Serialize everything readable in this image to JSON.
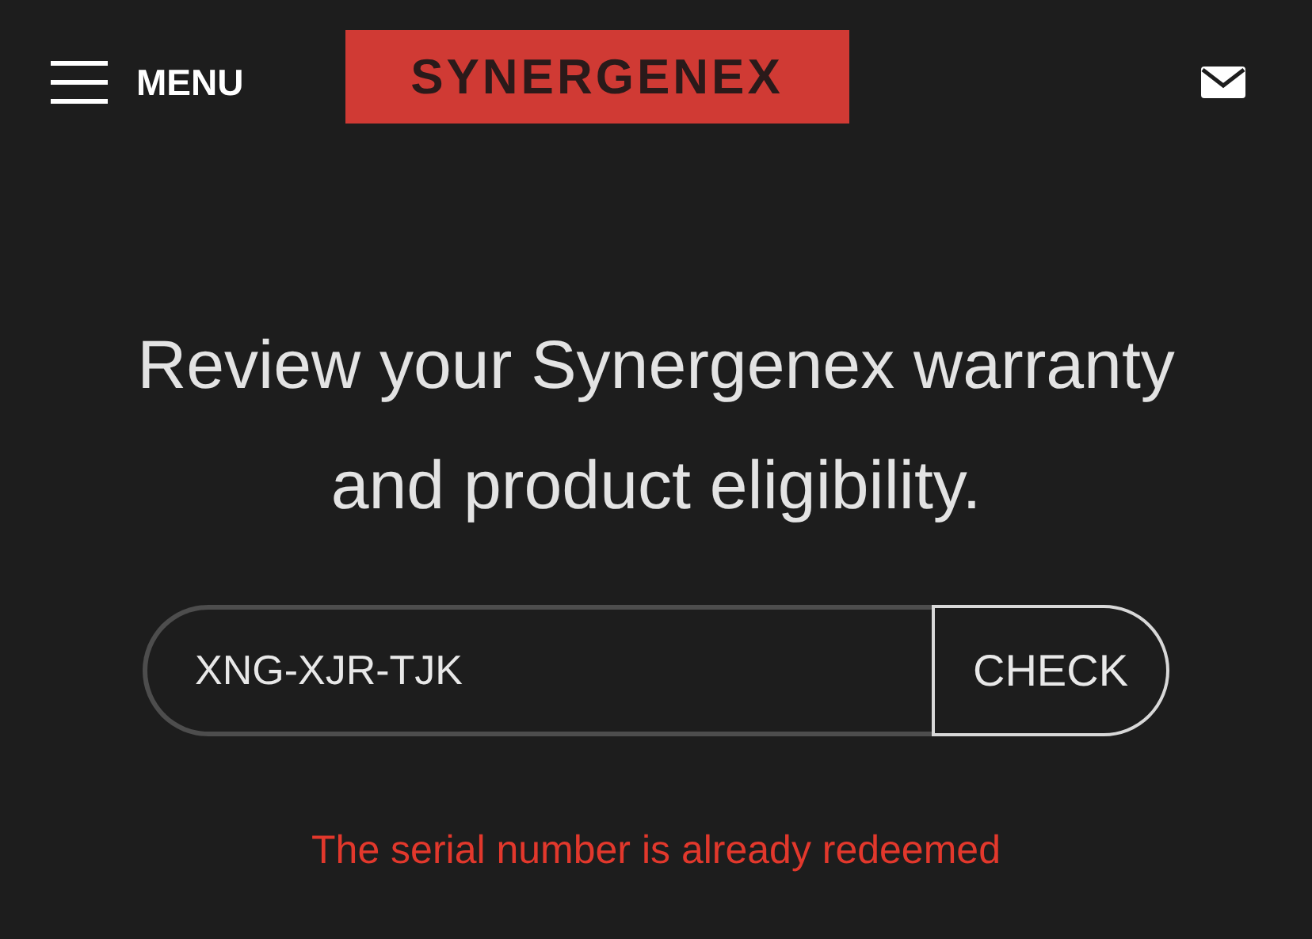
{
  "header": {
    "menu_label": "MENU",
    "logo": "SYNERGENEX"
  },
  "heading": "Review your Synergenex warranty and product eligibility.",
  "serial_field": {
    "value": "XNG-XJR-TJK"
  },
  "check_button": "CHECK",
  "error_message": "The serial number is already redeemed"
}
